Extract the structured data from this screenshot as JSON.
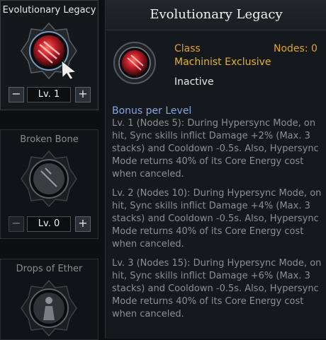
{
  "skill_list": {
    "items": [
      {
        "title": "Evolutionary Legacy",
        "level": "Lv. 1",
        "minus": "−",
        "plus": "+"
      },
      {
        "title": "Broken Bone",
        "level": "Lv. 0",
        "minus": "−",
        "plus": "+"
      },
      {
        "title": "Drops of Ether"
      }
    ]
  },
  "tooltip": {
    "title": "Evolutionary Legacy",
    "class_label": "Class",
    "nodes_label": "Nodes: 0",
    "class_value": "Machinist Exclusive",
    "status": "Inactive",
    "bonus_title": "Bonus per Level",
    "levels": [
      "Lv. 1 (Nodes 5): During Hypersync Mode, on hit, Sync skills inflict Damage +2% (Max. 3 stacks) and Cooldown -0.5s. Also, Hypersync Mode returns 40% of its Core Energy cost when canceled.",
      "Lv. 2 (Nodes 10): During Hypersync Mode, on hit, Sync skills inflict Damage +4% (Max. 3 stacks) and Cooldown -0.5s. Also, Hypersync Mode returns 40% of its Core Energy cost when canceled.",
      "Lv. 3 (Nodes 15): During Hypersync Mode, on hit, Sync skills inflict Damage +6% (Max. 3 stacks) and Cooldown -0.5s. Also, Hypersync Mode returns 40% of its Core Energy cost when canceled."
    ]
  },
  "icons": {
    "evolutionary": "red-energy-orb-icon",
    "broken_bone": "broken-bone-orb-icon",
    "drops_of_ether": "ether-figure-orb-icon",
    "cursor": "mouse-cursor-icon"
  },
  "colors": {
    "class_gold": "#e0a420",
    "bonus_blue": "#7fa6e6",
    "desc_gray": "#8c8f94"
  }
}
